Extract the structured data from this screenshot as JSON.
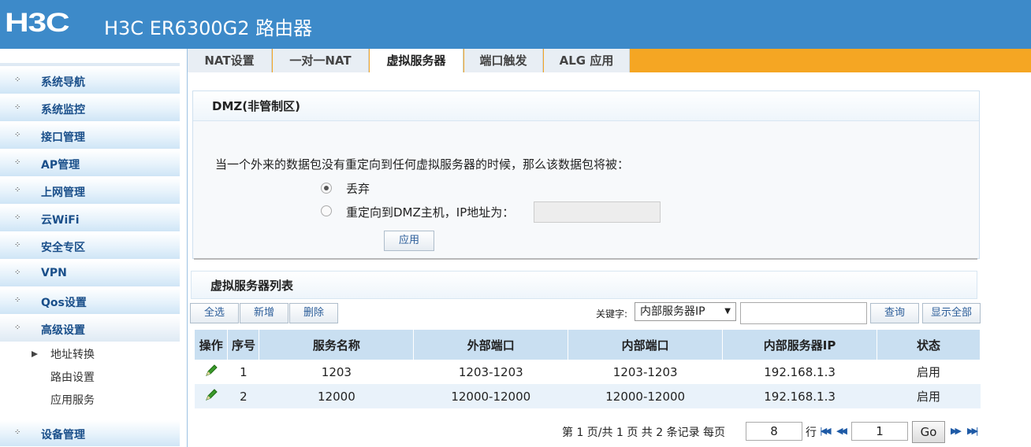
{
  "header": {
    "logo": "H3C",
    "title": "H3C ER6300G2 路由器"
  },
  "sidebar": {
    "items": [
      {
        "label": "系统导航"
      },
      {
        "label": "系统监控"
      },
      {
        "label": "接口管理"
      },
      {
        "label": "AP管理"
      },
      {
        "label": "上网管理"
      },
      {
        "label": "云WiFi"
      },
      {
        "label": "安全专区"
      },
      {
        "label": "VPN"
      },
      {
        "label": "Qos设置"
      },
      {
        "label": "高级设置"
      },
      {
        "label": "设备管理"
      }
    ],
    "sub_items": [
      {
        "label": "地址转换"
      },
      {
        "label": "路由设置"
      },
      {
        "label": "应用服务"
      }
    ]
  },
  "tabs": [
    {
      "label": "NAT设置"
    },
    {
      "label": "一对一NAT"
    },
    {
      "label": "虚拟服务器"
    },
    {
      "label": "端口触发"
    },
    {
      "label": "ALG 应用"
    }
  ],
  "active_tab": "虚拟服务器",
  "dmz": {
    "title": "DMZ(非管制区)",
    "description": "当一个外来的数据包没有重定向到任何虚拟服务器的时候，那么该数据包将被：",
    "option_discard": "丢弃",
    "option_redirect": "重定向到DMZ主机，IP地址为：",
    "selected": "丢弃",
    "ip_value": "",
    "apply_label": "应用"
  },
  "list": {
    "title": "虚拟服务器列表",
    "select_all": "全选",
    "add": "新增",
    "delete": "删除",
    "keyword_label": "关键字:",
    "keyword_selected": "内部服务器IP",
    "search_value": "",
    "query": "查询",
    "show_all": "显示全部",
    "columns": [
      "操作",
      "序号",
      "服务名称",
      "外部端口",
      "内部端口",
      "内部服务器IP",
      "状态"
    ],
    "rows": [
      {
        "index": "1",
        "name": "1203",
        "ext_port": "1203-1203",
        "int_port": "1203-1203",
        "ip": "192.168.1.3",
        "status": "启用"
      },
      {
        "index": "2",
        "name": "12000",
        "ext_port": "12000-12000",
        "int_port": "12000-12000",
        "ip": "192.168.1.3",
        "status": "启用"
      }
    ]
  },
  "pager": {
    "summary": "第 1 页/共 1 页 共 2 条记录 每页",
    "per_page": "8",
    "rows_unit": "行",
    "page": "1",
    "go": "Go"
  },
  "colors": {
    "header_bg": "#3d8ac9",
    "tab_accent": "#f5a623",
    "table_header": "#c9dff1"
  }
}
